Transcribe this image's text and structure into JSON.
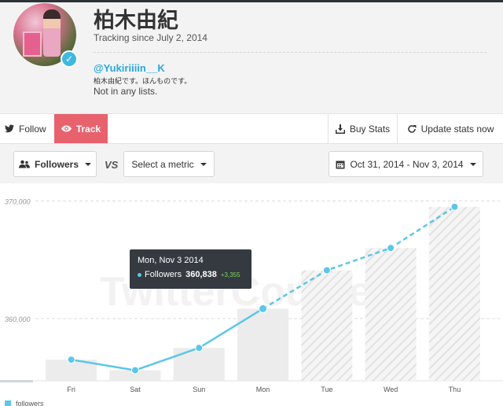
{
  "profile": {
    "name": "柏木由紀",
    "tracking_since": "Tracking since July 2, 2014",
    "handle": "@Yukiriiiin__K",
    "bio": "柏木由紀です。ほんものです。",
    "lists": "Not in any lists.",
    "avatar_icon": "avatar-photo",
    "verified_icon": "verified-check-icon"
  },
  "actions": {
    "follow": "Follow",
    "track": "Track",
    "buy_stats": "Buy Stats",
    "update_stats": "Update stats now"
  },
  "controls": {
    "metric": "Followers",
    "vs": "VS",
    "compare": "Select a metric",
    "date_range": "Oct 31, 2014 - Nov 3, 2014"
  },
  "tooltip": {
    "date": "Mon, Nov 3 2014",
    "metric": "Followers",
    "value": "360,838",
    "change": "+3,355"
  },
  "colors": {
    "accent": "#e8626e",
    "line": "#5bc6e8",
    "bar_actual": "#ececec",
    "bar_projected_hatch": "#e2e2e2"
  },
  "chart_data": {
    "type": "bar",
    "categories": [
      "Fri",
      "Sat",
      "Sun",
      "Mon",
      "Tue",
      "Wed",
      "Thu"
    ],
    "series": [
      {
        "name": "followers",
        "values": [
          356500,
          355600,
          357500,
          360838,
          364100,
          366000,
          369500
        ],
        "projected_from_index": 3
      }
    ],
    "y_ticks": [
      360000,
      370000
    ],
    "y_tick_labels": [
      "360,000",
      "370,000"
    ],
    "ylim": [
      354700,
      371500
    ],
    "grid": true,
    "legend": "bottom-left",
    "watermark": "TwitterCounter"
  }
}
